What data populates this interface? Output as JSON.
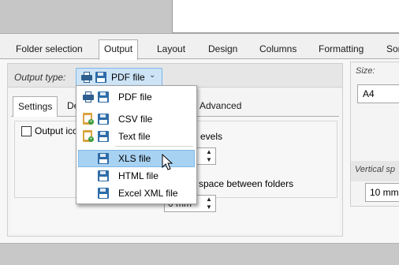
{
  "tabs": [
    "Folder selection",
    "Output",
    "Layout",
    "Design",
    "Columns",
    "Formatting",
    "Sor"
  ],
  "active_tab": "Output",
  "output_type": {
    "label": "Output type:",
    "selected": "PDF file"
  },
  "inner_tabs": [
    "Settings",
    "De",
    "Advanced"
  ],
  "active_inner_tab": "Settings",
  "settings": {
    "output_icons_label": "Output ico",
    "levels_label": "evels",
    "space_label": "space between folders",
    "space_value": "0 mm"
  },
  "right_panel": {
    "size_label": "Size:",
    "size_value": "A4",
    "vertical_label": "Vertical sp",
    "vertical_value": "10 mm"
  },
  "dropdown": {
    "items": [
      {
        "label": "PDF file",
        "icon": "printer-save-icon"
      },
      {
        "label": "CSV file",
        "icon": "clipboard-save-icon"
      },
      {
        "label": "Text file",
        "icon": "clipboard-save-icon"
      },
      {
        "label": "XLS file",
        "icon": "save-icon",
        "hover": true
      },
      {
        "label": "HTML file",
        "icon": "save-icon"
      },
      {
        "label": "Excel XML file",
        "icon": "save-icon"
      }
    ]
  },
  "colors": {
    "accent": "#cde4f7",
    "hover": "#a8d2f2",
    "icon_blue": "#2e6ca8"
  }
}
